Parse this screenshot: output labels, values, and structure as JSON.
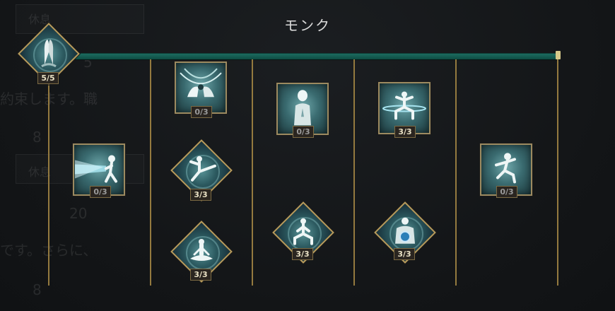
{
  "window": {
    "title": "モンク"
  },
  "progress": {
    "fraction": 0.995
  },
  "background_text": [
    {
      "id": "bg1",
      "text": "休息"
    },
    {
      "id": "bg2",
      "text": "5"
    },
    {
      "id": "bg3",
      "text": "約束します。職"
    },
    {
      "id": "bg4",
      "text": "8"
    },
    {
      "id": "bg5",
      "text": "休息"
    },
    {
      "id": "bg6",
      "text": "20"
    },
    {
      "id": "bg7",
      "text": "です。さらに、"
    },
    {
      "id": "bg8",
      "text": "8"
    }
  ],
  "nodes": [
    {
      "id": "root-prayer",
      "icon": "praying-hands-icon",
      "shape": "diamond",
      "count": "5/5"
    },
    {
      "id": "energy-beam",
      "icon": "energy-blast-icon",
      "shape": "square",
      "count": "0/3"
    },
    {
      "id": "swirling-hands",
      "icon": "swirling-hands-icon",
      "shape": "square",
      "count": "0/3"
    },
    {
      "id": "flying-kick",
      "icon": "flying-kick-icon",
      "shape": "diamond",
      "count": "3/3"
    },
    {
      "id": "seated-meditation",
      "icon": "meditation-icon",
      "shape": "diamond",
      "count": "3/3"
    },
    {
      "id": "inner-focus",
      "icon": "prayer-monk-icon",
      "shape": "square",
      "count": "0/3"
    },
    {
      "id": "horse-stance",
      "icon": "stance-icon",
      "shape": "diamond",
      "count": "3/3"
    },
    {
      "id": "wind-stance",
      "icon": "wind-stance-icon",
      "shape": "square",
      "count": "3/3"
    },
    {
      "id": "guardian-orb",
      "icon": "guardian-orb-icon",
      "shape": "diamond",
      "count": "3/3"
    },
    {
      "id": "leaping-strike",
      "icon": "leaping-monk-icon",
      "shape": "square",
      "count": "0/3"
    }
  ],
  "colors": {
    "accent_line": "#b89a52",
    "progress": "#1c6b5f",
    "node_fill": "#3a6b70"
  }
}
